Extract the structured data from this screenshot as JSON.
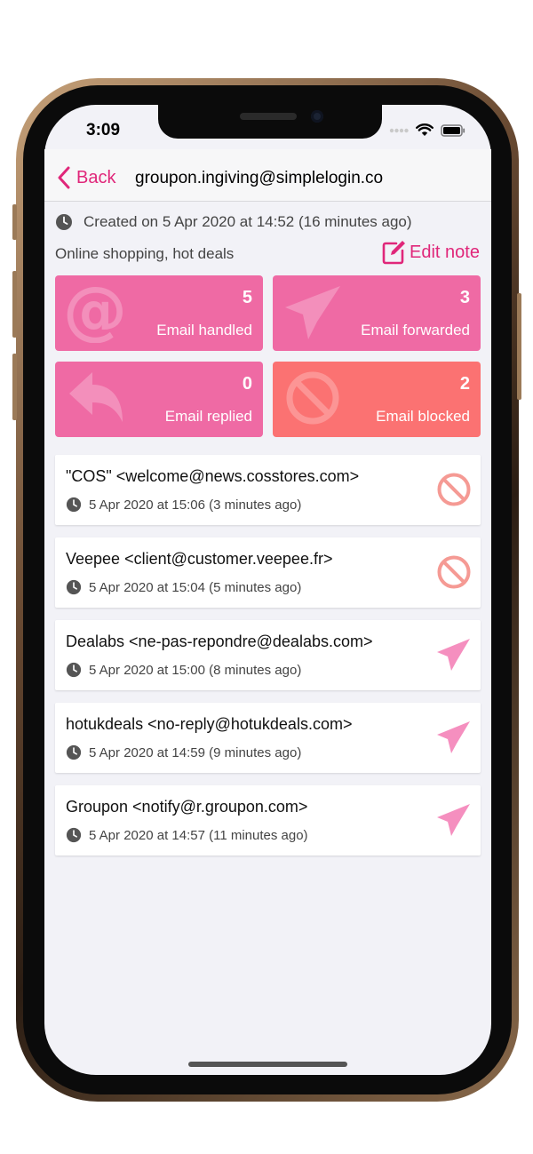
{
  "status_bar": {
    "time": "3:09"
  },
  "nav": {
    "back_label": "Back",
    "title": "groupon.ingiving@simplelogin.co"
  },
  "alias": {
    "created": "Created on 5 Apr 2020 at 14:52 (16 minutes ago)",
    "note": "Online shopping, hot deals",
    "edit_note_label": "Edit note"
  },
  "stats": {
    "handled": {
      "count": "5",
      "label": "Email handled"
    },
    "forwarded": {
      "count": "3",
      "label": "Email forwarded"
    },
    "replied": {
      "count": "0",
      "label": "Email replied"
    },
    "blocked": {
      "count": "2",
      "label": "Email blocked"
    }
  },
  "activities": [
    {
      "from": "\"COS\" <welcome@news.cosstores.com>",
      "time": "5 Apr 2020 at 15:06 (3 minutes ago)",
      "action": "block-icon"
    },
    {
      "from": "Veepee <client@customer.veepee.fr>",
      "time": "5 Apr 2020 at 15:04 (5 minutes ago)",
      "action": "block-icon"
    },
    {
      "from": "Dealabs <ne-pas-repondre@dealabs.com>",
      "time": "5 Apr 2020 at 15:00 (8 minutes ago)",
      "action": "paper-plane-icon"
    },
    {
      "from": "hotukdeals <no-reply@hotukdeals.com>",
      "time": "5 Apr 2020 at 14:59 (9 minutes ago)",
      "action": "paper-plane-icon"
    },
    {
      "from": "Groupon <notify@r.groupon.com>",
      "time": "5 Apr 2020 at 14:57 (11 minutes ago)",
      "action": "paper-plane-icon"
    }
  ],
  "colors": {
    "accent": "#e0277a",
    "stat_pink": "#ef6aa4",
    "stat_coral": "#fb7272",
    "block": "#f59a94",
    "forward": "#f58fbf"
  }
}
